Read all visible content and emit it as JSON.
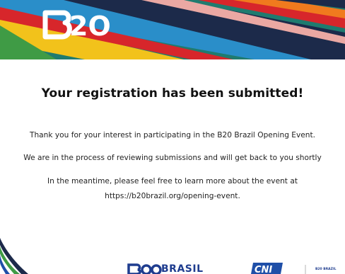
{
  "banner": {
    "logo_text": "B20"
  },
  "confirmation": {
    "heading": "Your registration has been submitted!",
    "paragraph1": "Thank you for your interest in participating in the B20 Brazil Opening Event.",
    "paragraph2": "We are in the process of reviewing submissions and will get back to you shortly",
    "paragraph3_line1": "In the meantime, please feel free to learn more about the event at",
    "paragraph3_line2": "https://b20brazil.org/opening-event."
  },
  "footer": {
    "brand_text": "BRASIL",
    "cni_text": "CNI",
    "small_logo_text": "B20 BRAZIL"
  },
  "colors": {
    "navy": "#1c2a4a",
    "teal": "#1f7b6f",
    "green": "#3f9b45",
    "yellow": "#f2c21b",
    "red": "#d7262b",
    "blue": "#1f4fa8",
    "brand_blue": "#1f3d8f"
  }
}
